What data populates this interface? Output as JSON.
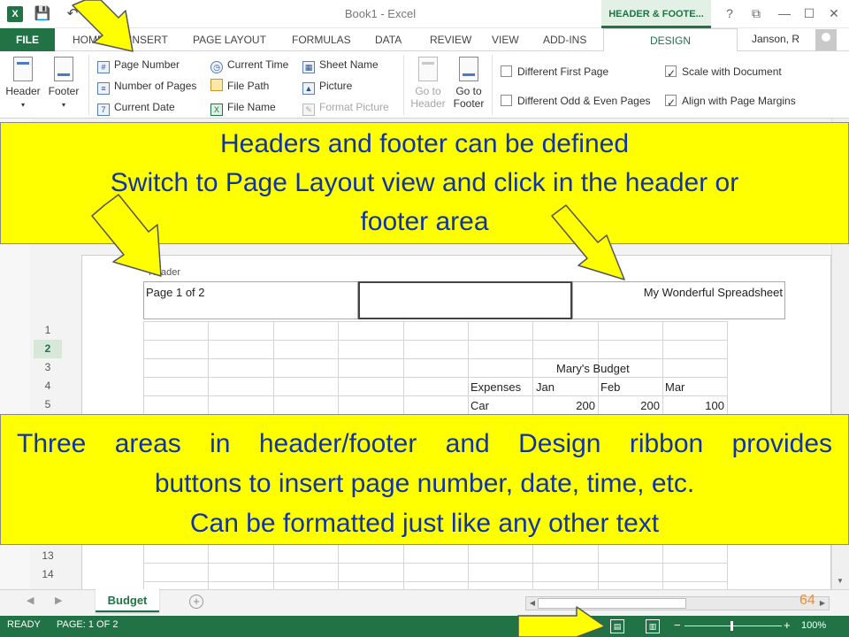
{
  "titlebar": {
    "app_icon": "X",
    "window_title": "Book1 - Excel",
    "context_tab": "HEADER & FOOTE...",
    "help": "?",
    "restore_ribbon": "⧉",
    "minimize": "—",
    "maximize": "☐",
    "close": "✕"
  },
  "tabs": {
    "file": "FILE",
    "home": "HOME",
    "insert": "INSERT",
    "page_layout": "PAGE LAYOUT",
    "formulas": "FORMULAS",
    "data": "DATA",
    "review": "REVIEW",
    "view": "VIEW",
    "addins": "ADD-INS",
    "design": "DESIGN",
    "user": "Janson, R"
  },
  "ribbon": {
    "header": "Header",
    "footer": "Footer",
    "page_number": "Page Number",
    "number_of_pages": "Number of Pages",
    "current_date": "Current Date",
    "current_time": "Current Time",
    "file_path": "File Path",
    "file_name": "File Name",
    "sheet_name": "Sheet Name",
    "picture": "Picture",
    "format_picture": "Format Picture",
    "go_to_header_1": "Go to",
    "go_to_header_2": "Header",
    "go_to_footer_1": "Go to",
    "go_to_footer_2": "Footer",
    "different_first_page": "Different First Page",
    "different_odd_even": "Different Odd & Even Pages",
    "scale_with_document": "Scale with Document",
    "align_with_margins": "Align with Page Margins"
  },
  "options": {
    "different_first_page": false,
    "different_odd_even": false,
    "scale_with_document": true,
    "align_with_margins": true
  },
  "page": {
    "header_label": "Header",
    "header_left": "Page 1 of 2",
    "header_center": "",
    "header_right": "My Wonderful Spreadsheet"
  },
  "rows": [
    "1",
    "2",
    "3",
    "4",
    "5",
    "13",
    "14"
  ],
  "cells": {
    "title": "Mary's Budget",
    "expenses": "Expenses",
    "jan": "Jan",
    "feb": "Feb",
    "mar": "Mar",
    "car": "Car",
    "car_jan": "200",
    "car_feb": "200",
    "car_mar": "100"
  },
  "sheet_tab": "Budget",
  "slide_number": "64",
  "status": {
    "ready": "READY",
    "page": "PAGE: 1 OF 2",
    "zoom": "100%"
  },
  "callouts": {
    "top_line1": "Headers and footer can be defined",
    "top_line2": "Switch to Page Layout view and click in the header or",
    "top_line3": "footer area",
    "bottom_line1": "Three areas in header/footer and Design ribbon provides",
    "bottom_line2": "buttons to insert page number, date, time, etc.",
    "bottom_line3": "Can be formatted just like any other text"
  },
  "colors": {
    "excel_green": "#217346",
    "callout_yellow": "#ffff00",
    "callout_text": "#1034a6",
    "arrow_yellow": "#ffff00"
  }
}
